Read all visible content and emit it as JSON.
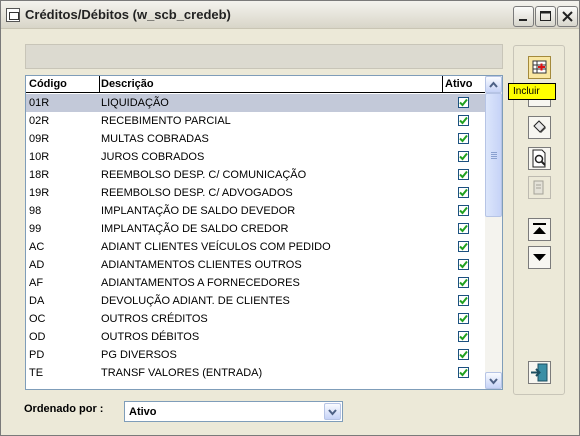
{
  "window": {
    "title": "Créditos/Débitos (w_scb_credeb)",
    "controls": [
      "minimize",
      "maximize",
      "close"
    ]
  },
  "grid": {
    "columns": {
      "code": "Código",
      "description": "Descrição",
      "active": "Ativo"
    },
    "selected_row": 0,
    "rows": [
      {
        "code": "01R",
        "description": "LIQUIDAÇÃO",
        "active": true
      },
      {
        "code": "02R",
        "description": "RECEBIMENTO PARCIAL",
        "active": true
      },
      {
        "code": "09R",
        "description": "MULTAS COBRADAS",
        "active": true
      },
      {
        "code": "10R",
        "description": "JUROS COBRADOS",
        "active": true
      },
      {
        "code": "18R",
        "description": "REEMBOLSO DESP. C/ COMUNICAÇÃO",
        "active": true
      },
      {
        "code": "19R",
        "description": "REEMBOLSO DESP. C/ ADVOGADOS",
        "active": true
      },
      {
        "code": "98",
        "description": "IMPLANTAÇÃO DE SALDO DEVEDOR",
        "active": true
      },
      {
        "code": "99",
        "description": "IMPLANTAÇÃO DE SALDO CREDOR",
        "active": true
      },
      {
        "code": "AC",
        "description": "ADIANT CLIENTES VEÍCULOS COM PEDIDO",
        "active": true
      },
      {
        "code": "AD",
        "description": "ADIANTAMENTOS CLIENTES OUTROS",
        "active": true
      },
      {
        "code": "AF",
        "description": "ADIANTAMENTOS A FORNECEDORES",
        "active": true
      },
      {
        "code": "DA",
        "description": "DEVOLUÇÃO ADIANT. DE CLIENTES",
        "active": true
      },
      {
        "code": "OC",
        "description": "OUTROS CRÉDITOS",
        "active": true
      },
      {
        "code": "OD",
        "description": "OUTROS DÉBITOS",
        "active": true
      },
      {
        "code": "PD",
        "description": "PG DIVERSOS",
        "active": true
      },
      {
        "code": "TE",
        "description": "TRANSF VALORES (ENTRADA)",
        "active": true
      }
    ]
  },
  "toolbar": {
    "tooltip": "Incluir",
    "buttons": [
      "add-record-icon",
      "edit-icon",
      "delete-icon",
      "preview-icon",
      "print-icon",
      "move-first-icon",
      "move-down-icon",
      "exit-icon"
    ]
  },
  "order": {
    "label": "Ordenado por :",
    "value": "Ativo"
  },
  "colors": {
    "selected_row": "#c3c9d9",
    "tooltip_bg": "#ffff00",
    "check": "#21a121"
  }
}
